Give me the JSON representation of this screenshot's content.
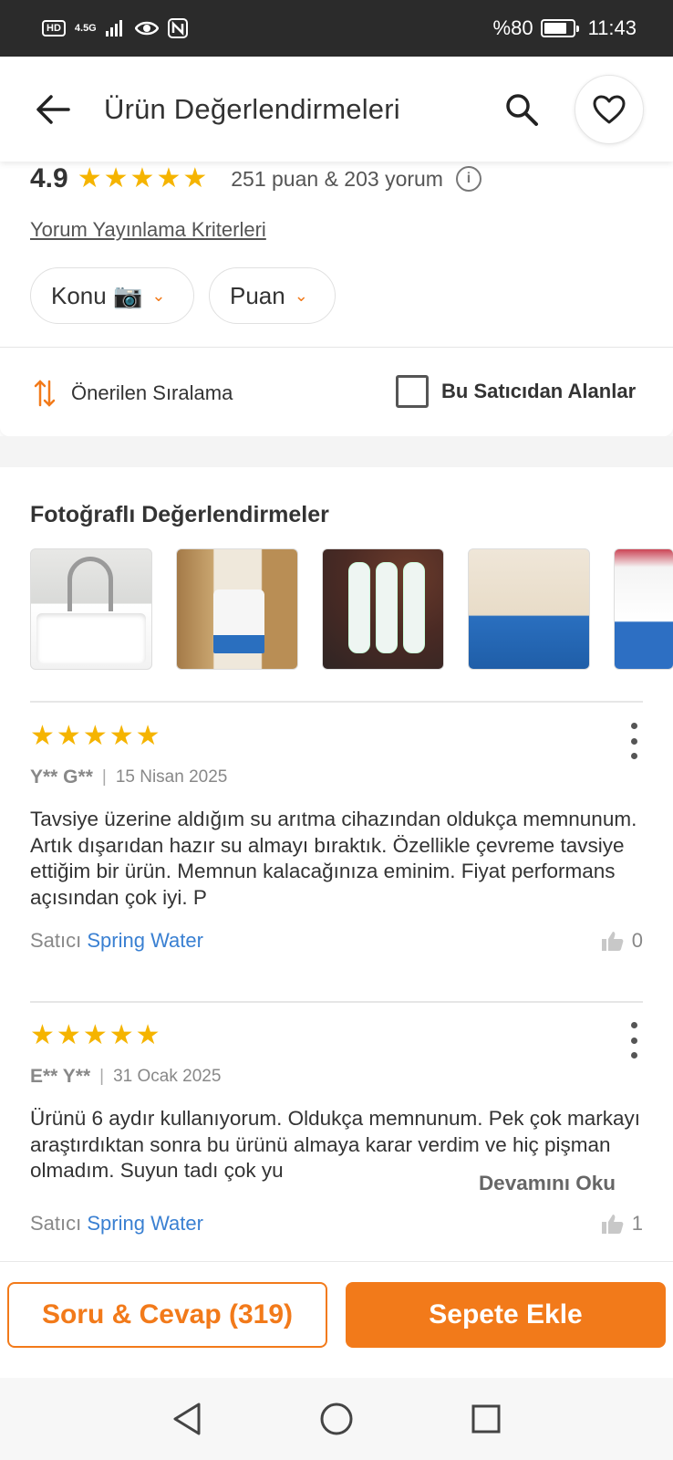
{
  "status_bar": {
    "left_hd": "HD",
    "left_network": "4.5G",
    "battery": "%80",
    "time": "11:43",
    "battery_level": 0.8
  },
  "header": {
    "title": "Ürün Değerlendirmeleri"
  },
  "summary": {
    "score": "4.9",
    "stars": 5,
    "counts": "251 puan & 203 yorum",
    "criteria_link": "Yorum Yayınlama Kriterleri",
    "filters": [
      {
        "label": "Konu 📷"
      },
      {
        "label": "Puan"
      }
    ]
  },
  "sort": {
    "label": "Önerilen Sıralama",
    "checkbox_label": "Bu Satıcıdan Alanlar",
    "checked": false
  },
  "photos": {
    "title": "Fotoğraflı Değerlendirmeler"
  },
  "reviews": [
    {
      "stars": 5,
      "author": "Y** G**",
      "date": "15 Nisan 2025",
      "text": "Tavsiye üzerine aldığım su arıtma cihazından oldukça memnunum. Artık dışarıdan hazır su almayı bıraktık. Özellikle çevreme tavsiye ettiğim bir ürün. Memnun kalacağınıza eminim. Fiyat performans açısından çok iyi. P",
      "seller_prefix": "Satıcı",
      "seller": "Spring Water",
      "likes": "0"
    },
    {
      "stars": 5,
      "author": "E** Y**",
      "date": "31 Ocak 2025",
      "text": "Ürünü 6 aydır kullanıyorum. Oldukça memnunum. Pek çok markayı araştırdıktan sonra bu ürünü almaya karar verdim ve hiç pişman olmadım. Suyun tadı çok yu",
      "read_more": "Devamını Oku",
      "seller_prefix": "Satıcı",
      "seller": "Spring Water",
      "likes": "1"
    }
  ],
  "bottom_bar": {
    "qa_label": "Soru & Cevap (319)",
    "cart_label": "Sepete Ekle"
  },
  "colors": {
    "accent": "#f27a1a",
    "star": "#f5b400",
    "seller_link": "#3a80d2"
  }
}
